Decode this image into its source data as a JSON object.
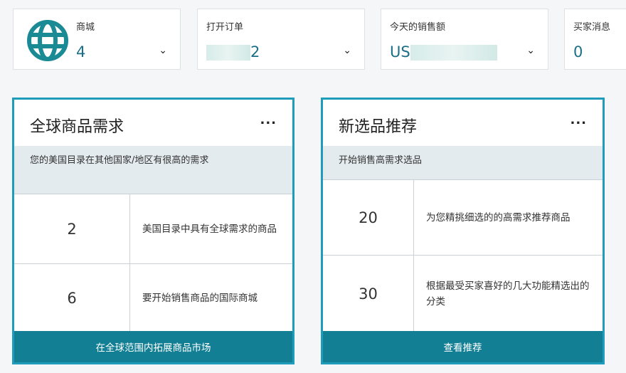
{
  "stats": [
    {
      "label": "商城",
      "value": "4",
      "icon": "globe-icon"
    },
    {
      "label": "打开订单",
      "value": "2"
    },
    {
      "label": "今天的销售额",
      "value": "US"
    },
    {
      "label": "买家消息",
      "value": "0"
    }
  ],
  "panels": [
    {
      "title": "全球商品需求",
      "more": "...",
      "band": "您的美国目录在其他国家/地区有很高的需求",
      "rows": [
        {
          "value": "2",
          "desc": "美国目录中具有全球需求的商品"
        },
        {
          "value": "6",
          "desc": "要开始销售商品的国际商城"
        }
      ],
      "button": "在全球范围内拓展商品市场"
    },
    {
      "title": "新选品推荐",
      "more": "...",
      "band": "开始销售高需求选品",
      "rows": [
        {
          "value": "20",
          "desc": "为您精挑细选的的高需求推荐商品"
        },
        {
          "value": "30",
          "desc": "根据最受买家喜好的几大功能精选出的分类"
        }
      ],
      "button": "查看推荐"
    }
  ],
  "colors": {
    "accent": "#1f9cb9",
    "button": "#137f94",
    "value": "#1b6f86"
  }
}
